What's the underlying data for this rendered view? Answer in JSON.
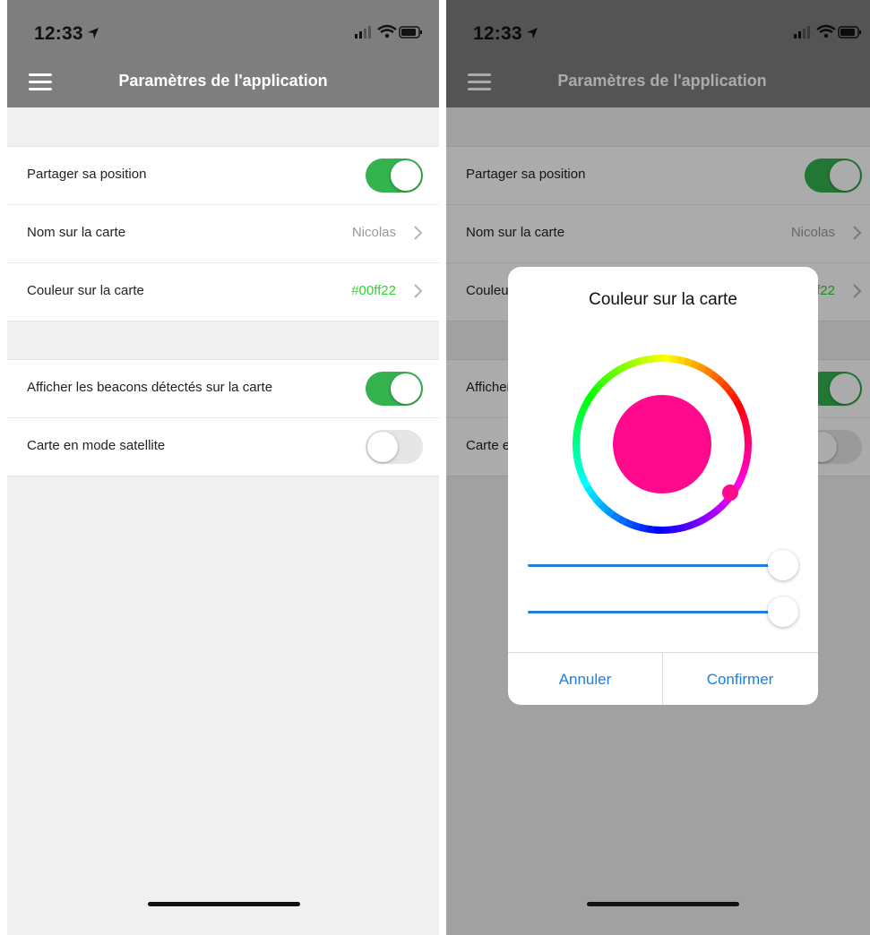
{
  "status_bar": {
    "time": "12:33",
    "location_glyph": "➤"
  },
  "header": {
    "title": "Paramètres de l'application",
    "menu_icon": "hamburger-icon"
  },
  "settings": {
    "group1": [
      {
        "label": "Partager sa position",
        "type": "toggle",
        "on": true
      },
      {
        "label": "Nom sur la carte",
        "type": "link",
        "value": "Nicolas"
      },
      {
        "label": "Couleur sur la carte",
        "type": "link",
        "value": "#00ff22",
        "value_color": "#2bd52b"
      }
    ],
    "group2": [
      {
        "label": "Afficher les beacons détectés sur la carte",
        "type": "toggle",
        "on": true
      },
      {
        "label": "Carte en mode satellite",
        "type": "toggle",
        "on": false
      }
    ]
  },
  "dialog": {
    "title": "Couleur sur la carte",
    "selected_color": "#ff0a8c",
    "sliders": [
      {
        "value": 1.0
      },
      {
        "value": 1.0
      }
    ],
    "cancel_label": "Annuler",
    "confirm_label": "Confirmer"
  },
  "colors": {
    "accent": "#1a7fe0",
    "toggle_on": "#34b24e",
    "header": "#7e7e7e"
  }
}
